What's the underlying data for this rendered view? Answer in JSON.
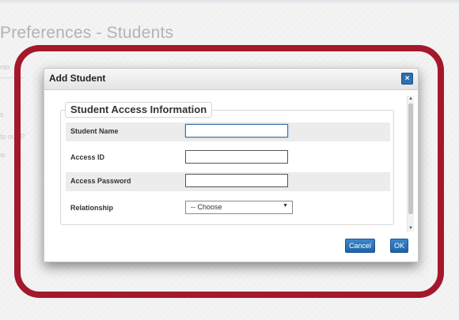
{
  "page": {
    "title": "Preferences - Students",
    "fragments": [
      "nto",
      "s",
      "to our P",
      "w"
    ]
  },
  "dialog": {
    "title": "Add Student",
    "close_label": "×",
    "section_title": "Student Access Information",
    "fields": [
      {
        "label": "Student Name",
        "value": "",
        "type": "text"
      },
      {
        "label": "Access ID",
        "value": "",
        "type": "text"
      },
      {
        "label": "Access Password",
        "value": "",
        "type": "password"
      },
      {
        "label": "Relationship",
        "value": "-- Choose",
        "type": "select"
      }
    ],
    "buttons": {
      "cancel": "Cancel",
      "ok": "OK"
    },
    "scroll": {
      "up": "▲",
      "down": "▼"
    }
  },
  "colors": {
    "highlight": "#a4182b",
    "primary_button": "#2c70b4"
  },
  "icons": {
    "close": "close-icon",
    "select_caret": "chevron-down-icon"
  }
}
